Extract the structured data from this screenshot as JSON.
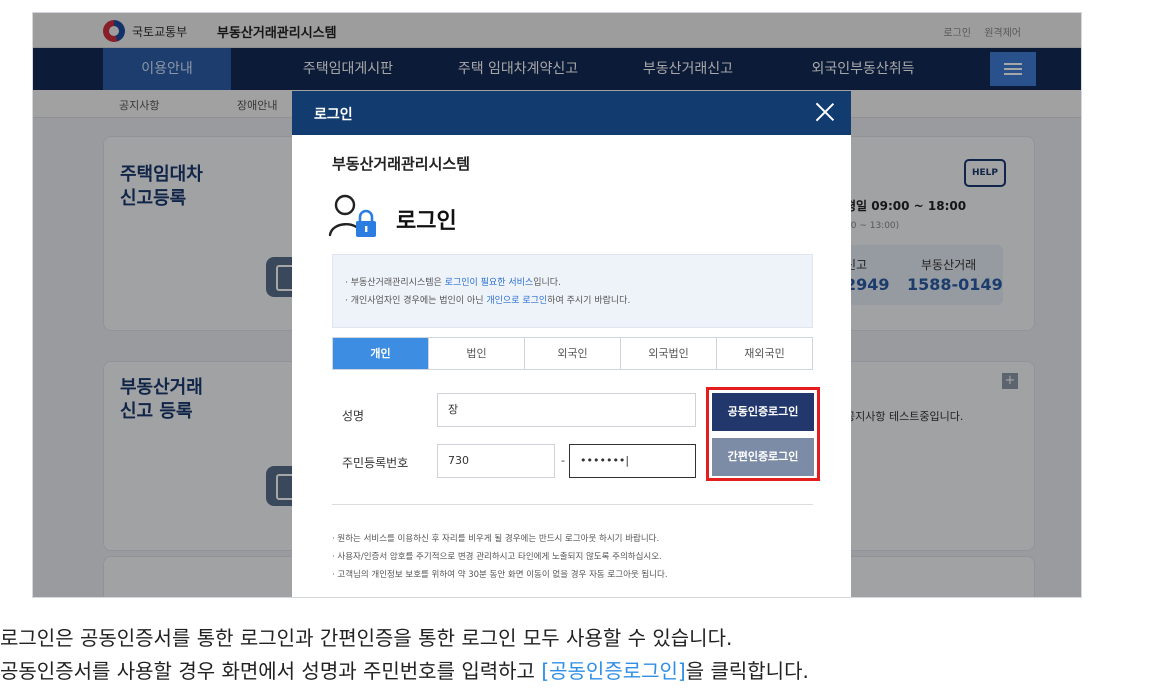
{
  "topbar": {
    "ministry": "국토교통부",
    "system_name": "부동산거래관리시스템",
    "links": [
      "로그인",
      "원격제어"
    ]
  },
  "nav": {
    "items": [
      "이용안내",
      "주택임대게시판",
      "주택 임대차계약신고",
      "부동산거래신고",
      "외국인부동산취득"
    ],
    "active_index": 0,
    "menu_icon": "hamburger-icon"
  },
  "subnav": {
    "items": [
      "공지사항",
      "장애안내"
    ]
  },
  "background": {
    "card1_title_line1": "주택임대차",
    "card1_title_line2": "신고등록",
    "card2_title_line1": "부동산거래",
    "card2_title_line2": "신고 등록",
    "help_label": "HELP",
    "help_hours": "평일 09:00 ~ 18:00",
    "help_hours_sub": "00 ~ 13:00)",
    "phone1_label": "신고",
    "phone1_number": "2949",
    "phone2_label": "부동산거래",
    "phone2_number": "1588-0149",
    "notice_text": "공지사항 테스트중입니다.",
    "plus_label": "+"
  },
  "modal": {
    "header_title": "로그인",
    "system_name": "부동산거래관리시스템",
    "login_title": "로그인",
    "info": {
      "line1_prefix": "· 부동산거래관리시스템은 ",
      "line1_link": "로그인이 필요한 서비스",
      "line1_suffix": "입니다.",
      "line2_prefix": "· 개인사업자인 경우에는 법인이 아닌 ",
      "line2_link": "개인으로 로그인",
      "line2_suffix": "하여 주시기 바랍니다."
    },
    "tabs": [
      "개인",
      "법인",
      "외국인",
      "외국법인",
      "재외국민"
    ],
    "active_tab": 0,
    "form": {
      "name_label": "성명",
      "name_value": "장",
      "rrn_label": "주민등록번호",
      "rrn_front": "730",
      "rrn_dash": "-",
      "rrn_back": "•••••••|"
    },
    "buttons": {
      "cert_login": "공동인증로그인",
      "simple_login": "간편인증로그인"
    },
    "notes": [
      "· 원하는 서비스를 이용하신 후 자리를 비우게 될 경우에는 반드시 로그아웃 하시기 바랍니다.",
      "· 사용자/인증서 암호를 주기적으로 변경 관리하시고 타인에게 노출되지 않도록 주의하십시오.",
      "· 고객님의 개인정보 보호를 위하여 약 30분 동안 화면 이동이 없을 경우 자동 로그아웃 됩니다."
    ]
  },
  "caption": {
    "line1": "로그인은 공동인증서를 통한 로그인과 간편인증을 통한 로그인 모두 사용할 수 있습니다.",
    "line2_prefix": "공동인증서를 사용할 경우 화면에서 성명과 주민번호를 입력하고 ",
    "line2_link": "[공동인증로그인]",
    "line2_suffix": "을 클릭합니다."
  },
  "colors": {
    "nav_bg": "#112a57",
    "modal_header": "#123c70",
    "tab_active": "#3d8de3",
    "cert_button": "#22376c",
    "simple_button": "#7d8ca6",
    "highlight_box": "#e41e1e",
    "link_blue": "#2f8fe6"
  }
}
